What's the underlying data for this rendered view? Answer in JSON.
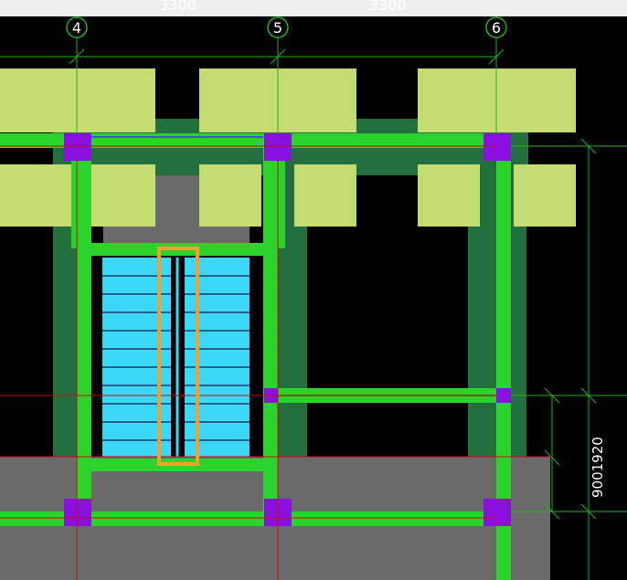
{
  "toolbar": {
    "partial_dim_left": "3300",
    "partial_dim_right": "3300"
  },
  "grid": {
    "axis_4": "4",
    "axis_5": "5",
    "axis_6": "6"
  },
  "dimensions": {
    "vertical_text": "9001920"
  },
  "colors": {
    "background": "#000000",
    "beam": "#2bd42b",
    "wall": "#22703e",
    "column": "#8a10e0",
    "slab_yellow": "#c4dc72",
    "stair": "#3ad8f6",
    "floor_gray": "#6a6a6a",
    "selection": "#f3a32c",
    "axis_green": "#20b020",
    "axis_red": "#c01010"
  }
}
